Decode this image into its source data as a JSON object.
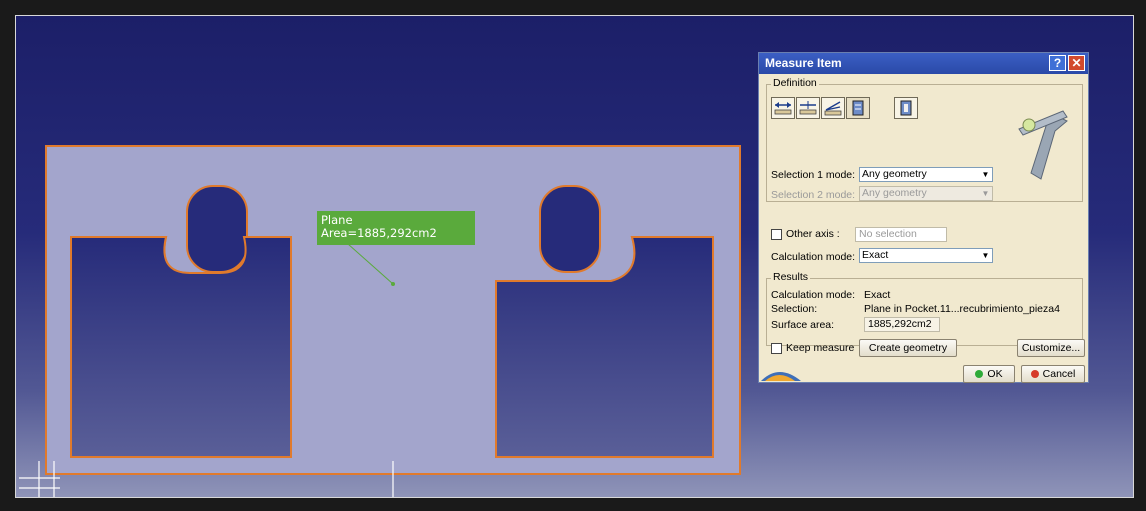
{
  "annotation": {
    "line1": "Plane",
    "line2": "Area=1885,292cm2"
  },
  "dialog": {
    "title": "Measure Item",
    "help_button": "?",
    "close_button": "✕",
    "definition": {
      "label": "Definition",
      "tools": [
        {
          "name": "measure-between-icon"
        },
        {
          "name": "measure-in-chain-icon"
        },
        {
          "name": "measure-fan-icon"
        },
        {
          "name": "measure-item-icon"
        },
        {
          "name": "measure-thickness-icon"
        }
      ],
      "selection1_label": "Selection 1 mode:",
      "selection1_value": "Any geometry",
      "selection2_label": "Selection 2 mode:",
      "selection2_value": "Any geometry",
      "other_axis_label": "Other axis :",
      "other_axis_value": "No selection",
      "calc_mode_label": "Calculation mode:",
      "calc_mode_value": "Exact"
    },
    "results": {
      "label": "Results",
      "calc_mode_label": "Calculation mode:",
      "calc_mode_value": "Exact",
      "selection_label": "Selection:",
      "selection_value": "Plane in Pocket.11...recubrimiento_pieza4",
      "surface_area_label": "Surface area:",
      "surface_area_value": "1885,292cm2"
    },
    "keep_measure_label": "Keep measure",
    "create_geometry_label": "Create geometry",
    "customize_label": "Customize...",
    "ok_label": "OK",
    "cancel_label": "Cancel"
  },
  "colors": {
    "part_fill": "#a3a5cc",
    "part_outline": "#e07a2c",
    "label_bg": "#5aaa3c",
    "ok_dot": "#2eaa3a",
    "cancel_dot": "#d63a2a"
  }
}
